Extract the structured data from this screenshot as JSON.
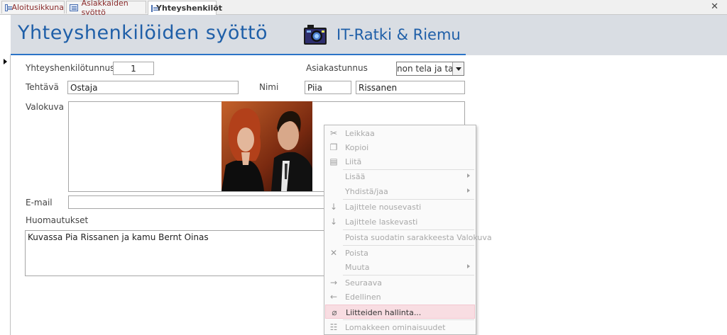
{
  "tabs": [
    {
      "label": "Aloitusikkuna"
    },
    {
      "label": "Asiakkaiden syöttö"
    },
    {
      "label": "Yhteyshenkilöt"
    }
  ],
  "close_glyph": "✕",
  "header": {
    "title": "Yhteyshenkilöiden syöttö",
    "brand": "IT-Ratki & Riemu"
  },
  "form": {
    "id_label": "Yhteyshenkilötunnus",
    "id_value": "1",
    "customer_label": "Asiakastunnus",
    "customer_value": "non tela ja tasa",
    "role_label": "Tehtävä",
    "role_value": "Ostaja",
    "name_label": "Nimi",
    "first_name": "Piia",
    "last_name": "Rissanen",
    "photo_label": "Valokuva",
    "email_label": "E-mail",
    "email_value": "",
    "notes_label": "Huomautukset",
    "notes_value": "Kuvassa Pia Rissanen ja kamu Bernt Oinas"
  },
  "context_menu": [
    {
      "label": "Leikkaa",
      "icon": "scissors-icon"
    },
    {
      "label": "Kopioi",
      "icon": "copy-icon"
    },
    {
      "label": "Liitä",
      "icon": "paste-icon"
    },
    {
      "label": "Lisää",
      "submenu": true
    },
    {
      "label": "Yhdistä/jaa",
      "submenu": true
    },
    {
      "label": "Lajittele nousevasti",
      "icon": "sort-ascending-icon"
    },
    {
      "label": "Lajittele laskevasti",
      "icon": "sort-descending-icon"
    },
    {
      "label": "Poista suodatin sarakkeesta Valokuva"
    },
    {
      "label": "Poista",
      "icon": "delete-icon"
    },
    {
      "label": "Muuta",
      "submenu": true
    },
    {
      "label": "Seuraava",
      "icon": "arrow-right-icon"
    },
    {
      "label": "Edellinen",
      "icon": "arrow-left-icon"
    },
    {
      "label": "Liitteiden hallinta...",
      "icon": "paperclip-icon",
      "highlighted": true
    },
    {
      "label": "Lomakkeen ominaisuudet",
      "icon": "properties-icon"
    }
  ]
}
